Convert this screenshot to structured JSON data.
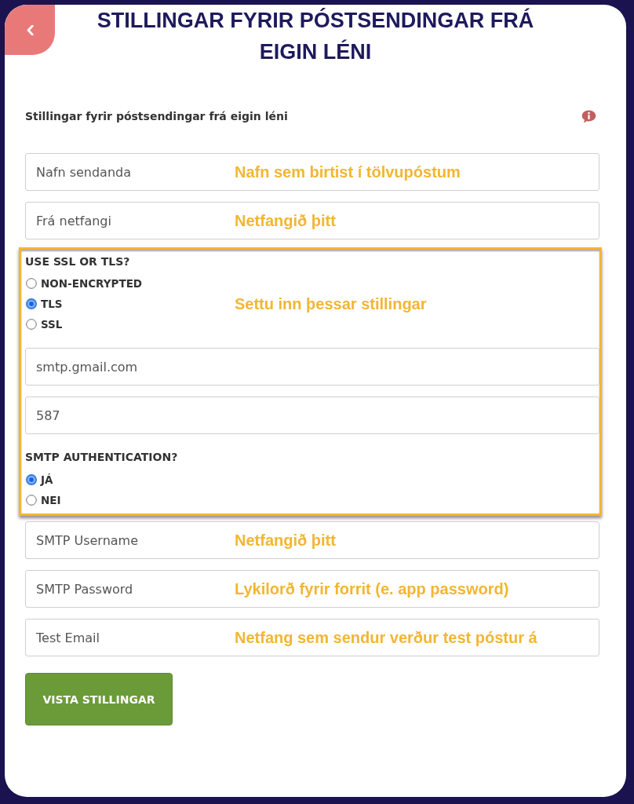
{
  "page": {
    "title": "STILLINGAR FYRIR PÓSTSENDINGAR FRÁ EIGIN LÉNI"
  },
  "section": {
    "heading": "Stillingar fyrir póstsendingar frá eigin léni"
  },
  "fields_top": [
    {
      "placeholder": "Nafn sendanda",
      "annotation": "Nafn sem birtist í tölvupóstum"
    },
    {
      "placeholder": "Frá netfangi",
      "annotation": "Netfangið þitt"
    }
  ],
  "highlight_box": {
    "annotation": "Settu inn þessar stillingar",
    "encryption": {
      "label": "USE SSL OR TLS?",
      "options": [
        {
          "label": "NON-ENCRYPTED",
          "selected": false
        },
        {
          "label": "TLS",
          "selected": true
        },
        {
          "label": "SSL",
          "selected": false
        }
      ]
    },
    "fields": [
      {
        "value": "smtp.gmail.com"
      },
      {
        "value": "587"
      }
    ],
    "authentication": {
      "label": "SMTP AUTHENTICATION?",
      "options": [
        {
          "label": "JÁ",
          "selected": true
        },
        {
          "label": "NEI",
          "selected": false
        }
      ]
    }
  },
  "fields_bottom": [
    {
      "placeholder": "SMTP Username",
      "annotation": "Netfangið þitt"
    },
    {
      "placeholder": "SMTP Password",
      "annotation": "Lykilorð fyrir forrit (e. app password)"
    },
    {
      "placeholder": "Test Email",
      "annotation": "Netfang sem sendur verður test póstur á"
    }
  ],
  "save_button": {
    "label": "VISTA STILLINGAR"
  }
}
